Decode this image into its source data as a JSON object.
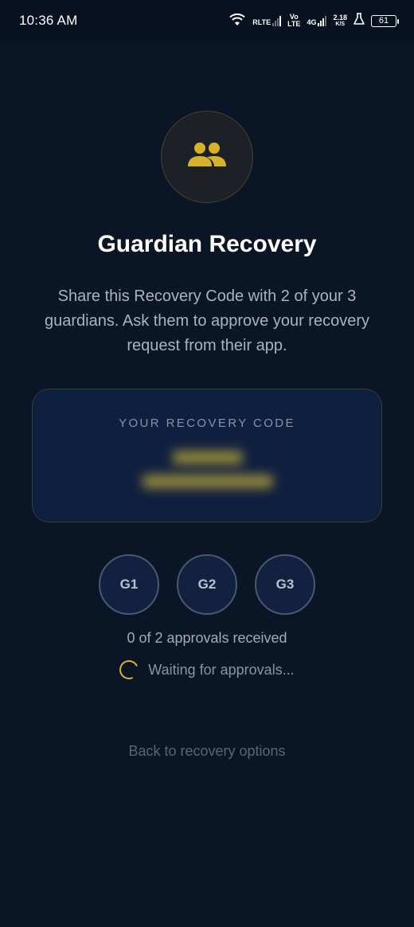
{
  "status_bar": {
    "time": "10:36 AM",
    "net1": "RLTE",
    "net2_top": "Vo",
    "net2_bottom": "LTE",
    "net3": "4G",
    "speed_value": "2.18",
    "speed_unit": "K/S",
    "battery": "61"
  },
  "hero": {
    "icon": "group-icon",
    "icon_color": "#d6b42a"
  },
  "title": "Guardian Recovery",
  "description": "Share this Recovery Code with 2 of your 3 guardians. Ask them to approve your recovery request from their app.",
  "code_card": {
    "label": "YOUR RECOVERY CODE"
  },
  "guardians": [
    {
      "label": "G1"
    },
    {
      "label": "G2"
    },
    {
      "label": "G3"
    }
  ],
  "approvals_text": "0 of 2 approvals received",
  "waiting_text": "Waiting for approvals...",
  "back_link": "Back to recovery options",
  "colors": {
    "background": "#0a1526",
    "accent": "#d6b42a",
    "card": "#0f1f3f"
  }
}
